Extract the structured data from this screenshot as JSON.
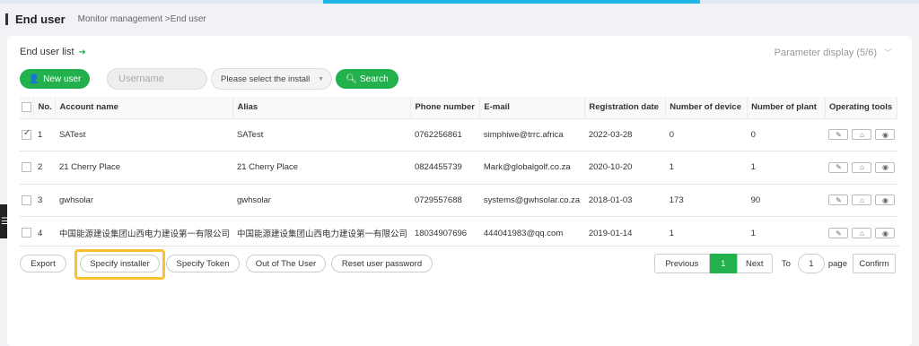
{
  "header": {
    "title": "End user",
    "breadcrumb": "Monitor management >End user"
  },
  "panel": {
    "list_title": "End user list",
    "param_display": "Parameter display  (5/6)"
  },
  "toolbar": {
    "new_user_label": "New user",
    "username_placeholder": "Username",
    "install_select_value": "Please select the install",
    "search_label": "Search"
  },
  "table": {
    "headers": [
      "No.",
      "Account name",
      "Alias",
      "Phone number",
      "E-mail",
      "Registration date",
      "Number of device",
      "Number of plant",
      "Operating tools"
    ],
    "rows": [
      {
        "no": "1",
        "account": "SATest",
        "alias": "SATest",
        "phone": "0762256861",
        "email": "simphiwe@trrc.africa",
        "date": "2022-03-28",
        "devices": "0",
        "plants": "0",
        "checked": true
      },
      {
        "no": "2",
        "account": "21 Cherry Place",
        "alias": "21 Cherry Place",
        "phone": "0824455739",
        "email": "Mark@globalgolf.co.za",
        "date": "2020-10-20",
        "devices": "1",
        "plants": "1",
        "checked": false
      },
      {
        "no": "3",
        "account": "gwhsolar",
        "alias": "gwhsolar",
        "phone": "0729557688",
        "email": "systems@gwhsolar.co.za",
        "date": "2018-01-03",
        "devices": "173",
        "plants": "90",
        "checked": false
      },
      {
        "no": "4",
        "account": "中国能源建设集团山西电力建设第一有限公司",
        "alias": "中国能源建设集团山西电力建设第一有限公司",
        "phone": "18034907696",
        "email": "444041983@qq.com",
        "date": "2019-01-14",
        "devices": "1",
        "plants": "1",
        "checked": false
      }
    ]
  },
  "actions": {
    "export": "Export",
    "specify_installer": "Specify installer",
    "specify_token": "Specify Token",
    "out_of_user": "Out of The User",
    "reset_password": "Reset user password"
  },
  "pager": {
    "previous": "Previous",
    "current": "1",
    "next": "Next",
    "to": "To",
    "goto_value": "1",
    "page": "page",
    "confirm": "Confirm"
  },
  "icons": {
    "edit": "edit-icon",
    "home": "home-icon",
    "view": "eye-icon"
  },
  "colors": {
    "accent_green": "#22b14c",
    "highlight": "#fbc02d"
  }
}
